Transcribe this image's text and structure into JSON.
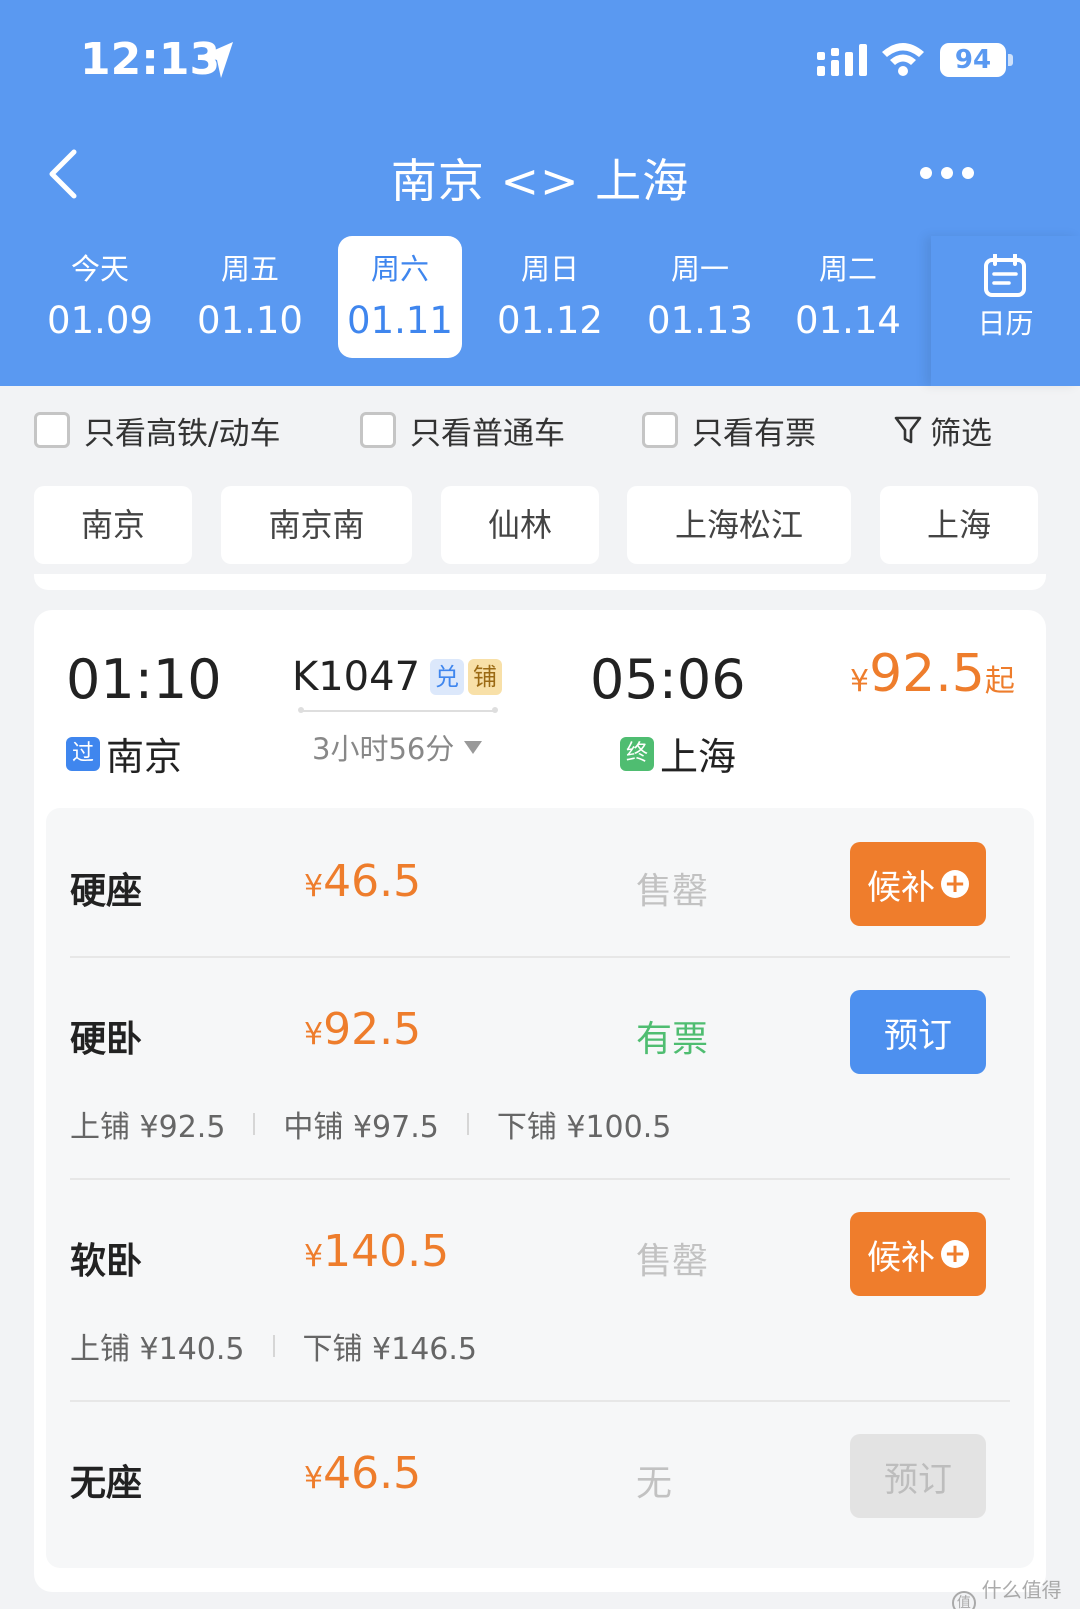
{
  "status_bar": {
    "time": "12:13",
    "battery": "94"
  },
  "nav": {
    "title": "南京 <> 上海"
  },
  "dates": [
    {
      "weekday": "今天",
      "date": "01.09"
    },
    {
      "weekday": "周五",
      "date": "01.10"
    },
    {
      "weekday": "周六",
      "date": "01.11",
      "selected": true
    },
    {
      "weekday": "周日",
      "date": "01.12"
    },
    {
      "weekday": "周一",
      "date": "01.13"
    },
    {
      "weekday": "周二",
      "date": "01.14"
    }
  ],
  "calendar_label": "日历",
  "filters": {
    "high_speed": "只看高铁/动车",
    "normal": "只看普通车",
    "available": "只看有票",
    "filter": "筛选"
  },
  "stations": [
    "南京",
    "南京南",
    "仙林",
    "上海松江",
    "上海"
  ],
  "train": {
    "depart_time": "01:10",
    "depart_tag": "过",
    "depart_station": "南京",
    "number": "K1047",
    "badge_1": "兑",
    "badge_2": "铺",
    "duration": "3小时56分",
    "arrive_time": "05:06",
    "arrive_tag": "终",
    "arrive_station": "上海",
    "price_symbol": "¥",
    "min_price": "92.5",
    "price_suffix": "起"
  },
  "seats": [
    {
      "name": "硬座",
      "symbol": "¥",
      "price": "46.5",
      "status": "售罄",
      "action": "候补",
      "plus": "+"
    },
    {
      "name": "硬卧",
      "symbol": "¥",
      "price": "92.5",
      "status": "有票",
      "action": "预订",
      "berths": [
        "上铺 ¥92.5",
        "中铺 ¥97.5",
        "下铺 ¥100.5"
      ]
    },
    {
      "name": "软卧",
      "symbol": "¥",
      "price": "140.5",
      "status": "售罄",
      "action": "候补",
      "plus": "+",
      "berths": [
        "上铺 ¥140.5",
        "下铺 ¥146.5"
      ]
    },
    {
      "name": "无座",
      "symbol": "¥",
      "price": "46.5",
      "status": "无",
      "action": "预订"
    }
  ],
  "watermark": {
    "icon": "值",
    "text": "什么值得买"
  },
  "colors": {
    "primary": "#5a99f1",
    "price": "#ee7d2c",
    "available": "#4fbd71",
    "wait_button": "#ef7d2c",
    "book_button": "#4d90ef"
  }
}
